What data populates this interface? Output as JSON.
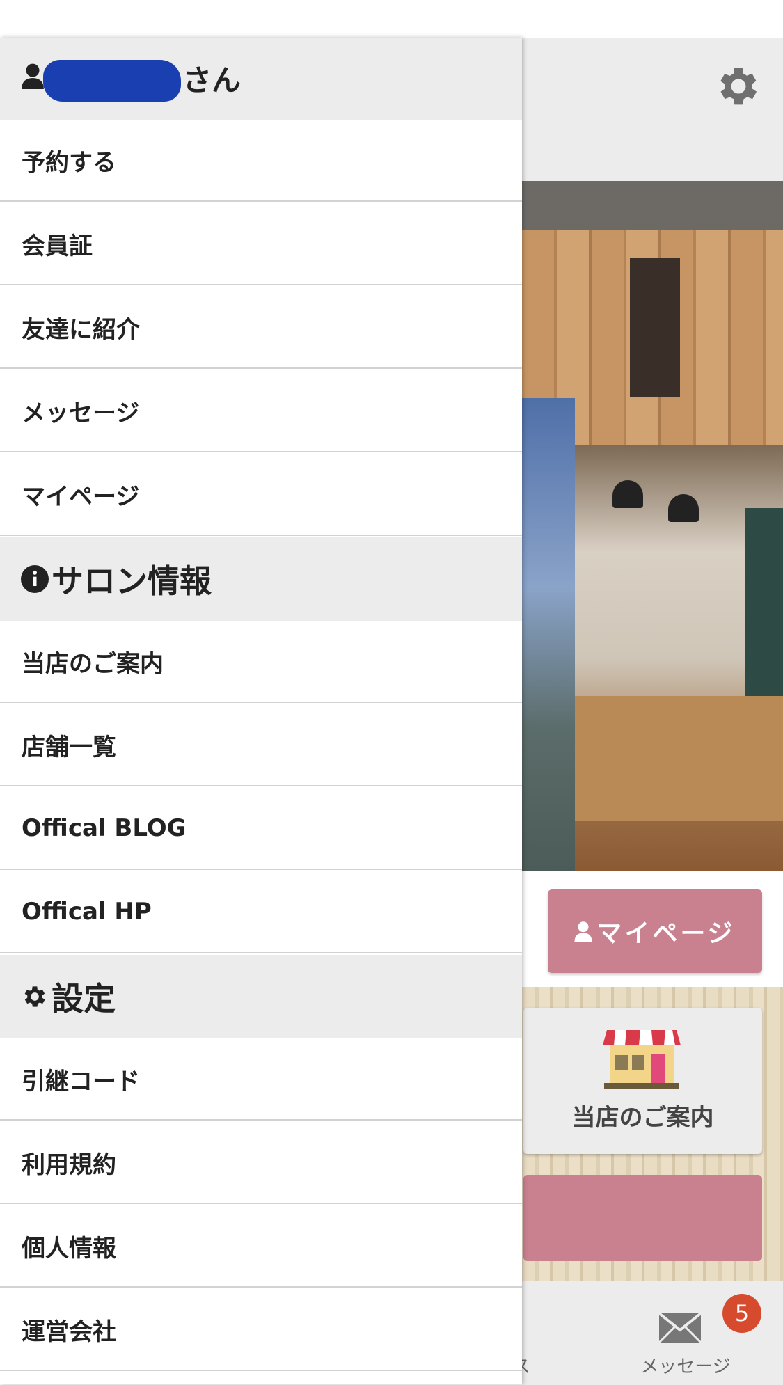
{
  "drawer": {
    "user_suffix": "さん",
    "menu_items": [
      {
        "label": "予約する"
      },
      {
        "label": "会員証"
      },
      {
        "label": "友達に紹介"
      },
      {
        "label": "メッセージ"
      },
      {
        "label": "マイページ"
      }
    ],
    "salon_section": {
      "title": "サロン情報",
      "icon": "info-circle-icon",
      "items": [
        {
          "label": "当店のご案内"
        },
        {
          "label": "店舗一覧"
        },
        {
          "label": "Offical BLOG"
        },
        {
          "label": "Offical HP"
        }
      ]
    },
    "settings_section": {
      "title": "設定",
      "icon": "gear-icon",
      "items": [
        {
          "label": "引継コード"
        },
        {
          "label": "利用規約"
        },
        {
          "label": "個人情報"
        },
        {
          "label": "運営会社"
        }
      ]
    }
  },
  "background": {
    "mypage_button": "マイページ",
    "store_card_label": "当店のご案内",
    "tab_message_label": "メッセージ",
    "tab_partial_label": "ス",
    "message_badge": "5"
  },
  "colors": {
    "accent_pink": "#c9808f",
    "badge_red": "#d64a2e",
    "section_bg": "#ececec",
    "redaction_blue": "#1a3fb0"
  }
}
